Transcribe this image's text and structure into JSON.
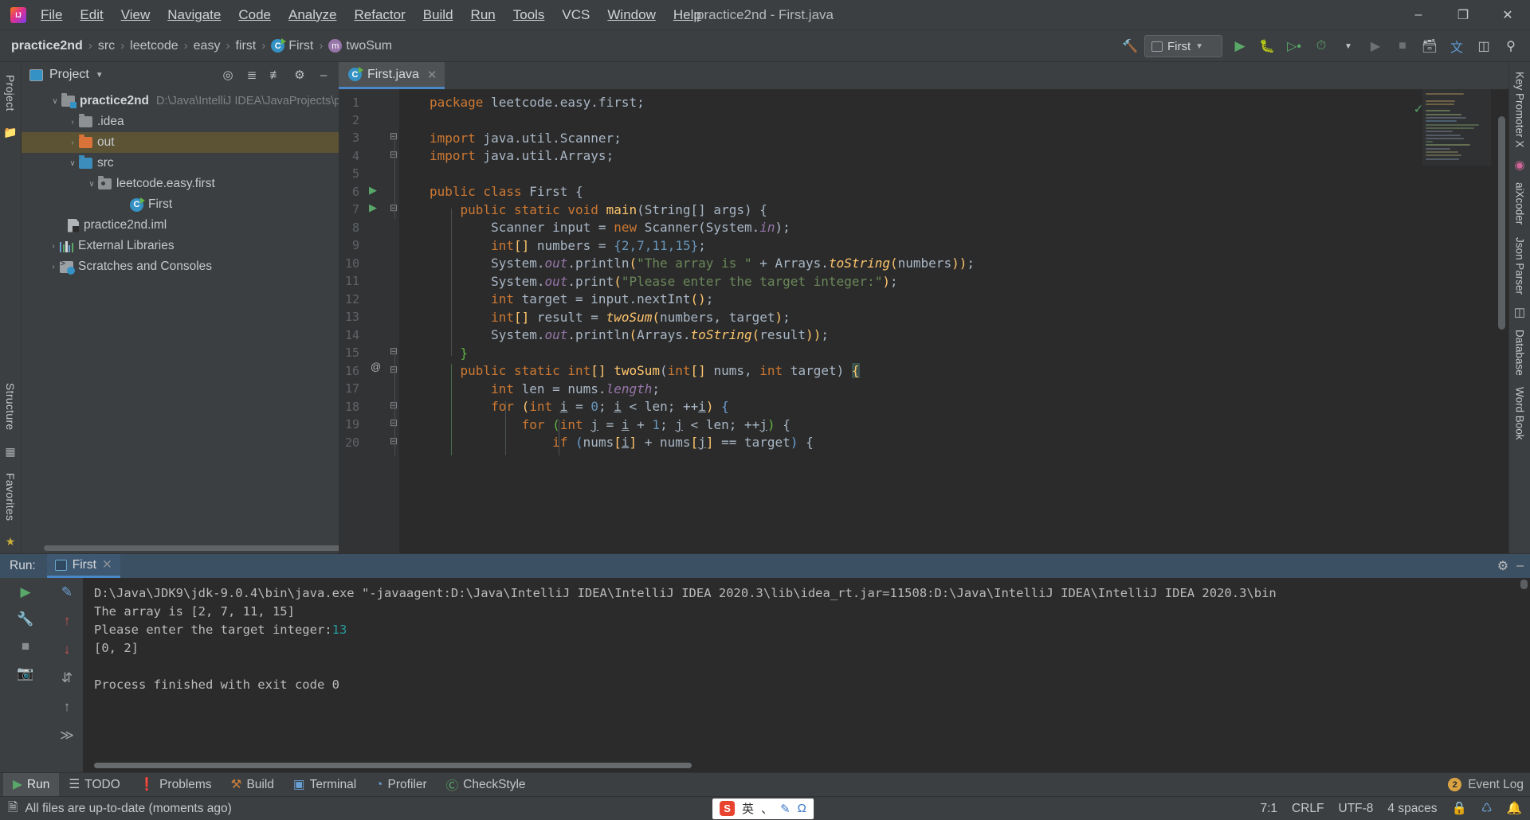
{
  "window": {
    "title": "practice2nd - First.java",
    "minimize": "–",
    "maximize": "❐",
    "close": "✕"
  },
  "menubar": [
    {
      "label": "File"
    },
    {
      "label": "Edit"
    },
    {
      "label": "View"
    },
    {
      "label": "Navigate"
    },
    {
      "label": "Code"
    },
    {
      "label": "Analyze"
    },
    {
      "label": "Refactor"
    },
    {
      "label": "Build"
    },
    {
      "label": "Run"
    },
    {
      "label": "Tools"
    },
    {
      "label": "VCS"
    },
    {
      "label": "Window"
    },
    {
      "label": "Help"
    }
  ],
  "breadcrumb": {
    "items": [
      "practice2nd",
      "src",
      "leetcode",
      "easy",
      "first",
      "First",
      "twoSum"
    ],
    "separator": "›"
  },
  "toolbar": {
    "run_config": "First",
    "hammer_icon": "build-icon",
    "run_icon": "▶",
    "debug_icon": "debug-icon",
    "coverage_icon": "coverage-icon",
    "profile_icon": "profile-icon",
    "stop_icon": "■",
    "search_icon": "⚲",
    "translate_icon": "translate-icon",
    "updates_icon": "updates-icon"
  },
  "project_panel": {
    "title": "Project",
    "actions": [
      "locate-icon",
      "expand-all-icon",
      "collapse-all-icon",
      "settings-icon",
      "hide-icon"
    ],
    "tree": [
      {
        "label": "practice2nd",
        "path": "D:\\Java\\IntelliJ IDEA\\JavaProjects\\pract",
        "icon": "module-folder",
        "arrow": "∨",
        "indent": 0,
        "bold": true,
        "selected": false
      },
      {
        "label": ".idea",
        "path": "",
        "icon": "folder-grey",
        "arrow": "›",
        "indent": 1,
        "bold": false,
        "selected": false
      },
      {
        "label": "out",
        "path": "",
        "icon": "folder-orange",
        "arrow": "›",
        "indent": 1,
        "bold": false,
        "selected": true
      },
      {
        "label": "src",
        "path": "",
        "icon": "folder-blue",
        "arrow": "∨",
        "indent": 1,
        "bold": false,
        "selected": false
      },
      {
        "label": "leetcode.easy.first",
        "path": "",
        "icon": "package",
        "arrow": "∨",
        "indent": 2,
        "bold": false,
        "selected": false
      },
      {
        "label": "First",
        "path": "",
        "icon": "java-class",
        "arrow": "",
        "indent": 3,
        "bold": false,
        "selected": false
      },
      {
        "label": "practice2nd.iml",
        "path": "",
        "icon": "iml-file",
        "arrow": "",
        "indent": 1,
        "bold": false,
        "selected": false
      },
      {
        "label": "External Libraries",
        "path": "",
        "icon": "libraries",
        "arrow": "›",
        "indent": 0,
        "bold": false,
        "selected": false
      },
      {
        "label": "Scratches and Consoles",
        "path": "",
        "icon": "scratches",
        "arrow": "›",
        "indent": 0,
        "bold": false,
        "selected": false
      }
    ]
  },
  "left_rail": {
    "project_label": "Project",
    "structure_label": "Structure",
    "favorites_label": "Favorites"
  },
  "right_rail": {
    "items": [
      "Key Promoter X",
      "aiXcoder",
      "Json Parser",
      "Database",
      "Word Book"
    ]
  },
  "editor": {
    "tab": {
      "label": "First.java",
      "close": "✕",
      "icon": "java-class-icon"
    },
    "lines": [
      {
        "n": 1,
        "text": "package leetcode.easy.first;"
      },
      {
        "n": 2,
        "text": ""
      },
      {
        "n": 3,
        "text": "import java.util.Scanner;"
      },
      {
        "n": 4,
        "text": "import java.util.Arrays;"
      },
      {
        "n": 5,
        "text": ""
      },
      {
        "n": 6,
        "text": "public class First {"
      },
      {
        "n": 7,
        "text": "    public static void main(String[] args) {"
      },
      {
        "n": 8,
        "text": "        Scanner input = new Scanner(System.in);"
      },
      {
        "n": 9,
        "text": "        int[] numbers = {2,7,11,15};"
      },
      {
        "n": 10,
        "text": "        System.out.println(\"The array is \" + Arrays.toString(numbers));"
      },
      {
        "n": 11,
        "text": "        System.out.print(\"Please enter the target integer:\");"
      },
      {
        "n": 12,
        "text": "        int target = input.nextInt();"
      },
      {
        "n": 13,
        "text": "        int[] result = twoSum(numbers, target);"
      },
      {
        "n": 14,
        "text": "        System.out.println(Arrays.toString(result));"
      },
      {
        "n": 15,
        "text": "    }"
      },
      {
        "n": 16,
        "text": "    public static int[] twoSum(int[] nums, int target) {"
      },
      {
        "n": 17,
        "text": "        int len = nums.length;"
      },
      {
        "n": 18,
        "text": "        for (int i = 0; i < len; ++i) {"
      },
      {
        "n": 19,
        "text": "            for (int j = i + 1; j < len; ++j) {"
      },
      {
        "n": 20,
        "text": "                if (nums[i] + nums[j] == target) {"
      }
    ],
    "inspection_status": "✓"
  },
  "run_window": {
    "label": "Run:",
    "tab": "First",
    "tab_close": "✕",
    "settings_icon": "⚙",
    "hide_icon": "–",
    "side_icons": [
      "▶",
      "⚒",
      "■",
      "⎙"
    ],
    "side_icons2": [
      "✎",
      "↑",
      "↓",
      "⇅",
      "↑",
      "↓"
    ],
    "console_lines": [
      {
        "text": "D:\\Java\\JDK9\\jdk-9.0.4\\bin\\java.exe \"-javaagent:D:\\Java\\IntelliJ IDEA\\IntelliJ IDEA 2020.3\\lib\\idea_rt.jar=11508:D:\\Java\\IntelliJ IDEA\\IntelliJ IDEA 2020.3\\bin",
        "green": ""
      },
      {
        "text": "The array is [2, 7, 11, 15]",
        "green": ""
      },
      {
        "text": "Please enter the target integer:",
        "green": "13"
      },
      {
        "text": "[0, 2]",
        "green": ""
      },
      {
        "text": "",
        "green": ""
      },
      {
        "text": "Process finished with exit code 0",
        "green": ""
      }
    ]
  },
  "bottom_bar": {
    "items": [
      {
        "label": "Run",
        "icon": "▶",
        "active": true
      },
      {
        "label": "TODO",
        "icon": "☰",
        "active": false
      },
      {
        "label": "Problems",
        "icon": "❗",
        "active": false
      },
      {
        "label": "Build",
        "icon": "⚒",
        "active": false
      },
      {
        "label": "Terminal",
        "icon": "▣",
        "active": false
      },
      {
        "label": "Profiler",
        "icon": "◔",
        "active": false
      },
      {
        "label": "CheckStyle",
        "icon": "Ⓒ",
        "active": false
      }
    ],
    "event_log": "Event Log",
    "event_count": "2"
  },
  "status_bar": {
    "message": "All files are up-to-date (moments ago)",
    "caret": "7:1",
    "line_sep": "CRLF",
    "encoding": "UTF-8",
    "indent": "4 spaces",
    "lock_icon": "ὑ2",
    "ime": {
      "letter": "S",
      "mode": "英",
      "punct": "、",
      "pen": "✎",
      "omega": "Ω"
    }
  },
  "colors": {
    "accent": "#4a88c7",
    "selected_row": "#5b5334",
    "editor_bg": "#2b2b2b",
    "panel_bg": "#3c3f41",
    "keyword": "#cc7832",
    "string": "#6a8759",
    "number": "#6897bb",
    "method": "#ffc66d",
    "field": "#9876aa",
    "green_run": "#59a869"
  }
}
